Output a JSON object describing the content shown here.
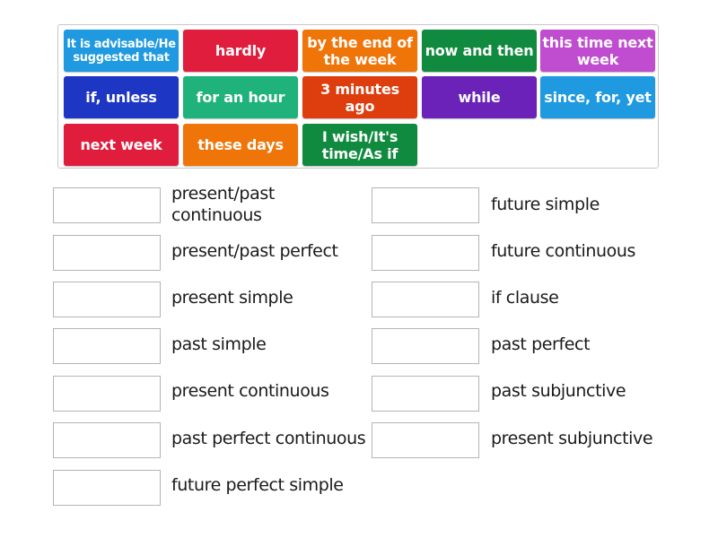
{
  "tiles": [
    {
      "label": "It is advisable/He suggested that",
      "color": "#1f9ae0"
    },
    {
      "label": "hardly",
      "color": "#e01d3c"
    },
    {
      "label": "by the end of the week",
      "color": "#f07508"
    },
    {
      "label": "now and then",
      "color": "#108a3e"
    },
    {
      "label": "this time next week",
      "color": "#c04ccf"
    },
    {
      "label": "if, unless",
      "color": "#1e36c4"
    },
    {
      "label": "for an hour",
      "color": "#1fb27a"
    },
    {
      "label": "3 minutes ago",
      "color": "#de3d0e"
    },
    {
      "label": "while",
      "color": "#6a22b8"
    },
    {
      "label": "since, for, yet",
      "color": "#1f9ae0"
    },
    {
      "label": "next week",
      "color": "#e01d3c"
    },
    {
      "label": "these days",
      "color": "#f07508"
    },
    {
      "label": "I wish/It's time/As if",
      "color": "#108a3e"
    }
  ],
  "targets_left": [
    {
      "label": "present/past continuous"
    },
    {
      "label": "present/past perfect"
    },
    {
      "label": "present simple"
    },
    {
      "label": "past simple"
    },
    {
      "label": "present continuous"
    },
    {
      "label": "past perfect continuous"
    },
    {
      "label": "future perfect simple"
    }
  ],
  "targets_right": [
    {
      "label": "future simple"
    },
    {
      "label": "future continuous"
    },
    {
      "label": "if clause"
    },
    {
      "label": "past perfect"
    },
    {
      "label": "past subjunctive"
    },
    {
      "label": "present subjunctive"
    }
  ]
}
